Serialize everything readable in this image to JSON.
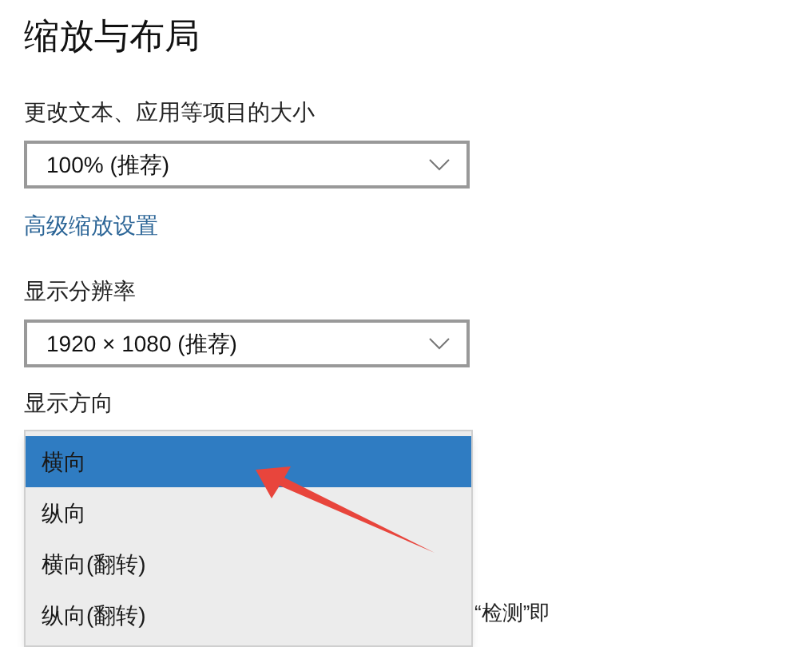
{
  "title": "缩放与布局",
  "scale": {
    "label": "更改文本、应用等项目的大小",
    "value": "100% (推荐)"
  },
  "advanced_link": "高级缩放设置",
  "resolution": {
    "label": "显示分辨率",
    "value": "1920 × 1080 (推荐)"
  },
  "orientation": {
    "label": "显示方向",
    "options": [
      {
        "label": "横向",
        "selected": true
      },
      {
        "label": "纵向",
        "selected": false
      },
      {
        "label": "横向(翻转)",
        "selected": false
      },
      {
        "label": "纵向(翻转)",
        "selected": false
      }
    ]
  },
  "background_text": "“检测”即"
}
